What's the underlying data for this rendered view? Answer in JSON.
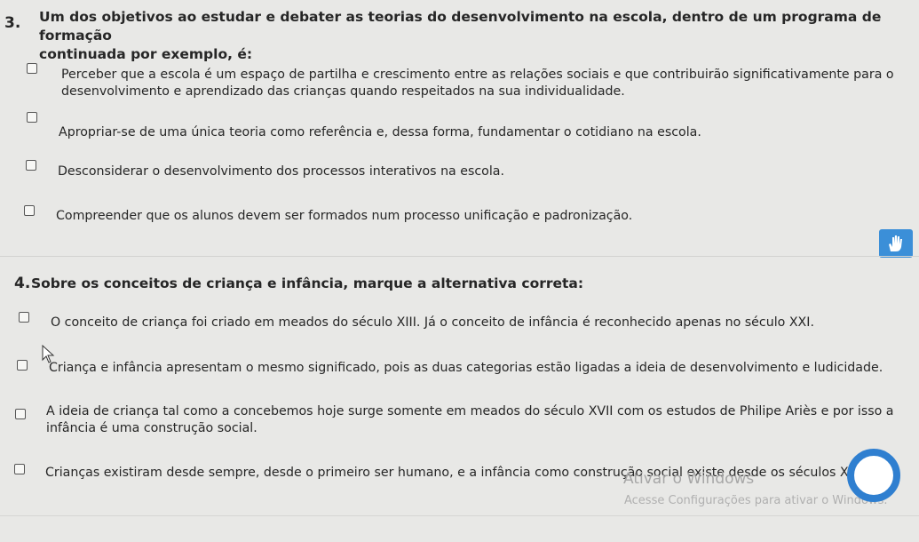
{
  "question3": {
    "number": "3.",
    "title_line1": "Um dos objetivos ao estudar e debater as teorias do desenvolvimento na escola, dentro de um programa de formação",
    "title_line2": "continuada por exemplo, é:",
    "options": [
      {
        "line1": "Perceber que a escola é um espaço de partilha e crescimento entre as relações sociais e que contribuirão significativamente para o",
        "line2": "desenvolvimento e aprendizado das crianças quando respeitados na sua individualidade."
      },
      {
        "line1": "Apropriar-se de uma única teoria como referência e, dessa forma, fundamentar o cotidiano na escola."
      },
      {
        "line1": "Desconsiderar o desenvolvimento dos processos interativos na escola."
      },
      {
        "line1": "Compreender que os alunos devem ser formados num processo unificação e padronização."
      }
    ]
  },
  "question4": {
    "number": "4.",
    "title": "Sobre os conceitos de criança e infância, marque a alternativa correta:",
    "options": [
      {
        "line1": "O conceito de criança foi criado em meados do século XIII. Já o conceito de infância é reconhecido apenas no século XXI."
      },
      {
        "line1": "Criança e infância apresentam o mesmo significado, pois as duas categorias estão ligadas a ideia de desenvolvimento e ludicidade."
      },
      {
        "line1": "A ideia de criança tal como a concebemos hoje surge somente em meados do século XVII com os estudos de Philipe Ariès e por isso a",
        "line2": "infância é uma construção social."
      },
      {
        "line1": "Crianças existiram desde sempre, desde o primeiro ser humano, e a infância como construção social existe desde os séculos XX."
      }
    ]
  },
  "watermark": {
    "title": "Ativar o Windows",
    "subtitle": "Acesse Configurações para ativar o Windows."
  },
  "colors": {
    "background": "#e8e8e6",
    "accent": "#2f7fd0"
  },
  "icons": {
    "helper": "sign-language-icon",
    "pointer": "mouse-pointer-icon",
    "circle": "circle-button-icon"
  }
}
